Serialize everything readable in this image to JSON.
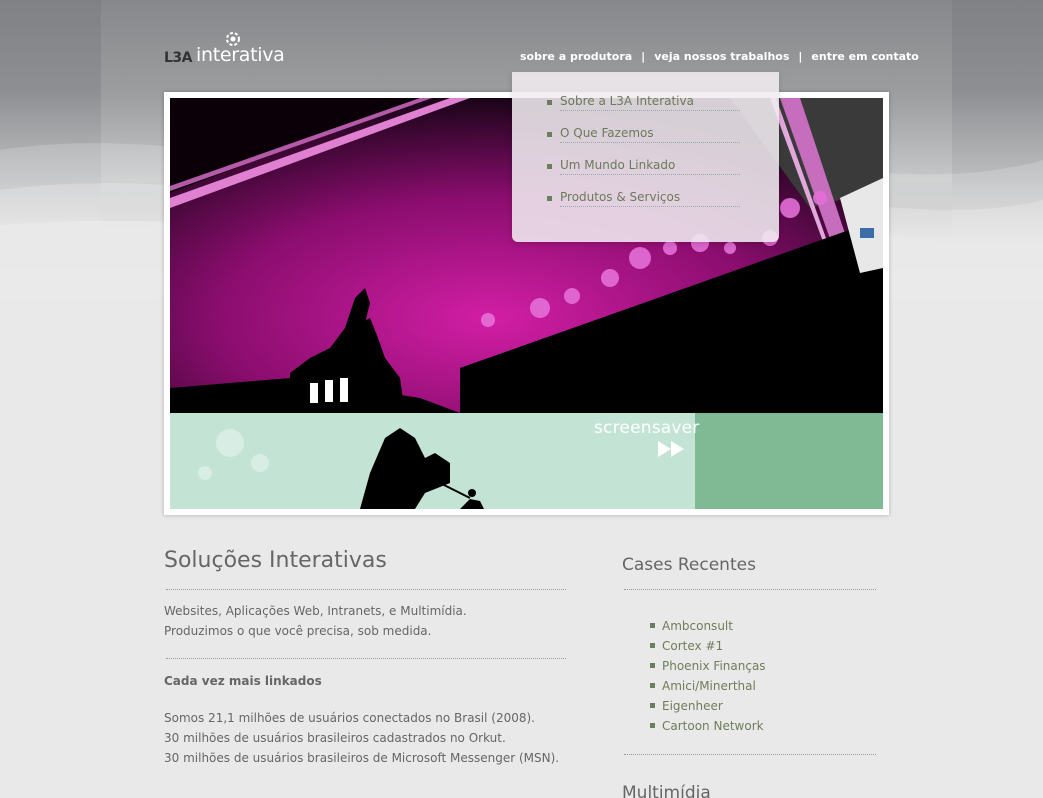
{
  "brand": {
    "logo_prefix": "L3A",
    "logo_word": "interativa"
  },
  "nav": {
    "items": [
      "sobre a produtora",
      "veja nossos trabalhos",
      "entre em  contato"
    ],
    "separator": "|"
  },
  "dropdown": {
    "items": [
      "Sobre a L3A Interativa",
      "O Que Fazemos",
      "Um Mundo Linkado",
      "Produtos & Serviços"
    ]
  },
  "hero": {
    "caption": "screensaver",
    "icon": "fast-forward-icon"
  },
  "main": {
    "title": "Soluções Interativas",
    "intro_lines": [
      "Websites, Aplicações Web, Intranets, e Multimídia.",
      "Produzimos o que você precisa, sob medida."
    ],
    "section_heading": "Cada vez mais linkados",
    "stats_lines": [
      "Somos 21,1 milhões de usuários conectados no Brasil (2008).",
      "30 milhões de usuários brasileiros cadastrados no Orkut.",
      "30 milhões de usuários brasileiros de Microsoft Messenger (MSN)."
    ]
  },
  "sidebar": {
    "cases_title": "Cases Recentes",
    "cases": [
      "Ambconsult",
      "Cortex #1",
      "Phoenix Finanças",
      "Amici/Minerthal",
      "Eigenheer",
      "Cartoon Network"
    ],
    "next_title": "Multimídia"
  },
  "colors": {
    "link_green": "#6f7d5a",
    "bullet": "#6b7f5c",
    "hero_magenta": "#b0148a",
    "hero_mint": "#c3e4d4",
    "hero_green": "#7fba95"
  }
}
